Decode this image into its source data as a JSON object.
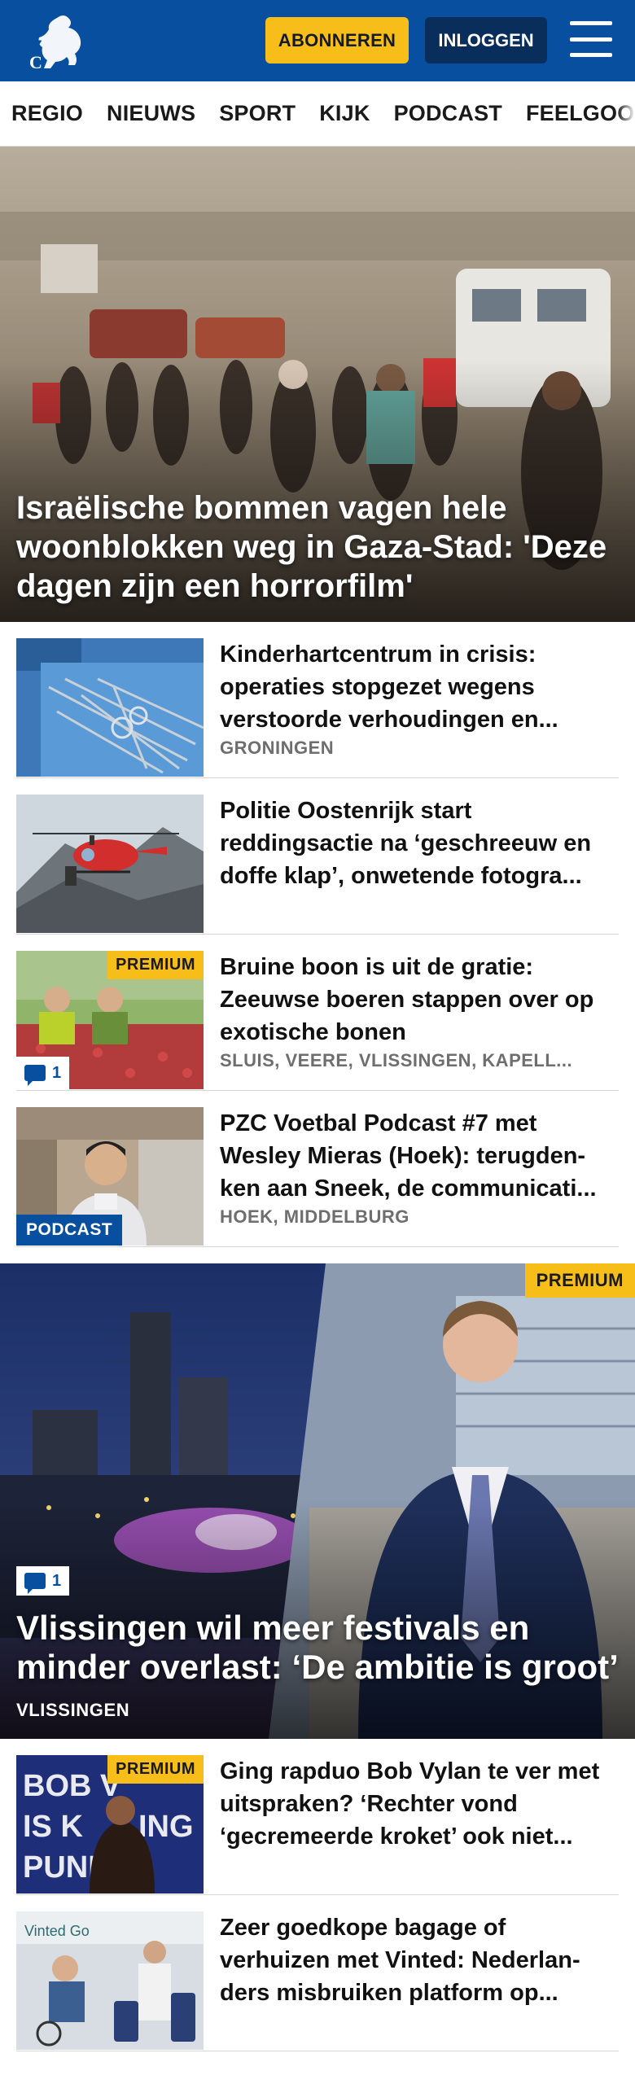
{
  "header": {
    "logo_text": "PZC",
    "subscribe_label": "ABONNEREN",
    "login_label": "INLOGGEN",
    "menu_icon": "hamburger-menu-icon",
    "brand_color": "#08509f",
    "accent_color": "#f7bd18"
  },
  "nav": {
    "items": [
      "REGIO",
      "NIEUWS",
      "SPORT",
      "KIJK",
      "PODCAST",
      "FEELGOOD"
    ]
  },
  "hero": {
    "title": "Israëlische bommen vagen hele woonblokken weg in Gaza-Stad: 'Deze dagen zijn een horrorfilm'"
  },
  "articles": [
    {
      "title": "Kinderhartcentrum in crisis: operaties stopgezet wegens verstoorde verhoudingen en...",
      "tag": "GRONINGEN"
    },
    {
      "title": "Politie Oostenrijk start reddingsactie na ‘geschreeuw en doffe klap’, onwetende fotogra...",
      "tag": ""
    },
    {
      "title": "Bruine boon is uit de gratie: Zeeuwse boeren stappen over op exotische bonen",
      "tag": "SLUIS, VEERE, VLISSINGEN, KAPELL...",
      "premium": "PREMIUM",
      "comments": "1"
    },
    {
      "title": "PZC Voetbal Podcast #7 met Wesley Mieras (Hoek): terugden-ken aan Sneek, de communicati...",
      "tag": "HOEK, MIDDELBURG",
      "badge": "PODCAST"
    }
  ],
  "feature": {
    "premium": "PREMIUM",
    "comments": "1",
    "title": "Vlissingen wil meer festivals en minder overlast: ‘De ambitie is groot’",
    "tag": "VLISSINGEN"
  },
  "articles2": [
    {
      "title": "Ging rapduo Bob Vylan te ver met uitspraken? ‘Rechter vond ‘gecremeerde kroket’ ook niet...",
      "premium": "PREMIUM"
    },
    {
      "title": "Zeer goedkope bagage of verhuizen met Vinted: Nederlan-ders misbruiken platform op..."
    }
  ]
}
